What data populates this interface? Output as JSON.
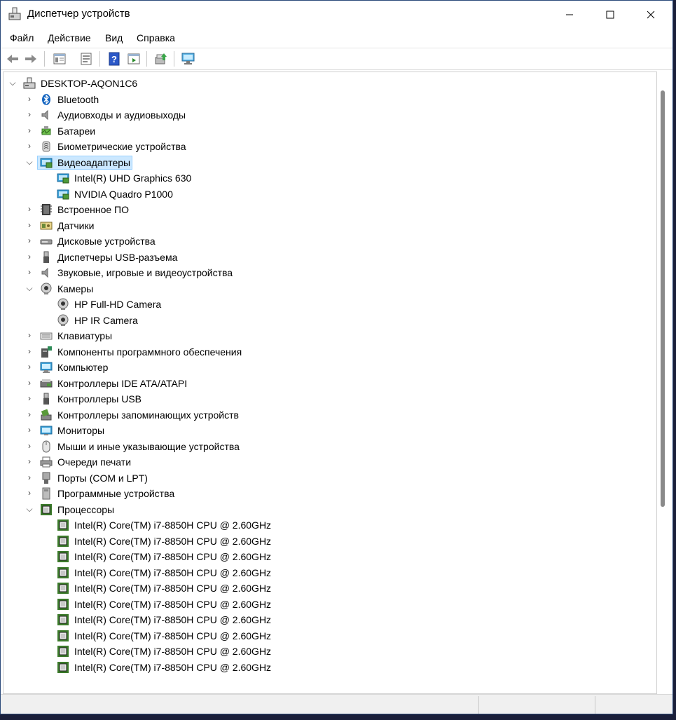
{
  "window": {
    "title": "Диспетчер устройств",
    "controls": [
      "minimize",
      "maximize",
      "close"
    ],
    "accent": "#0078d4"
  },
  "menu": [
    "Файл",
    "Действие",
    "Вид",
    "Справка"
  ],
  "toolbar": [
    "back-icon",
    "forward-icon",
    "properties-view-icon",
    "device-properties-icon",
    "help-icon",
    "show-hidden-icon",
    "update-driver-icon",
    "scan-hardware-icon"
  ],
  "tree": {
    "root": "DESKTOP-AQON1C6",
    "selected": "Видеоадаптеры",
    "rows": [
      {
        "label": "Bluetooth",
        "level": 1,
        "expand": "collapsed",
        "icon": "bluetooth-icon"
      },
      {
        "label": "Аудиовходы и аудиовыходы",
        "level": 1,
        "expand": "collapsed",
        "icon": "audio-icon"
      },
      {
        "label": "Батареи",
        "level": 1,
        "expand": "collapsed",
        "icon": "battery-icon"
      },
      {
        "label": "Биометрические устройства",
        "level": 1,
        "expand": "collapsed",
        "icon": "fingerprint-icon"
      },
      {
        "label": "Видеоадаптеры",
        "level": 1,
        "expand": "expanded",
        "icon": "display-adapter-icon"
      },
      {
        "label": "Intel(R) UHD Graphics 630",
        "level": 2,
        "expand": "none",
        "icon": "display-adapter-icon"
      },
      {
        "label": "NVIDIA Quadro P1000",
        "level": 2,
        "expand": "none",
        "icon": "display-adapter-icon"
      },
      {
        "label": "Встроенное ПО",
        "level": 1,
        "expand": "collapsed",
        "icon": "firmware-icon"
      },
      {
        "label": "Датчики",
        "level": 1,
        "expand": "collapsed",
        "icon": "sensor-icon"
      },
      {
        "label": "Дисковые устройства",
        "level": 1,
        "expand": "collapsed",
        "icon": "disk-icon"
      },
      {
        "label": "Диспетчеры USB-разъема",
        "level": 1,
        "expand": "collapsed",
        "icon": "usb-icon"
      },
      {
        "label": "Звуковые, игровые и видеоустройства",
        "level": 1,
        "expand": "collapsed",
        "icon": "audio-icon"
      },
      {
        "label": "Камеры",
        "level": 1,
        "expand": "expanded",
        "icon": "camera-icon"
      },
      {
        "label": "HP Full-HD Camera",
        "level": 2,
        "expand": "none",
        "icon": "camera-icon"
      },
      {
        "label": "HP IR Camera",
        "level": 2,
        "expand": "none",
        "icon": "camera-icon"
      },
      {
        "label": "Клавиатуры",
        "level": 1,
        "expand": "collapsed",
        "icon": "keyboard-icon"
      },
      {
        "label": "Компоненты программного обеспечения",
        "level": 1,
        "expand": "collapsed",
        "icon": "software-component-icon"
      },
      {
        "label": "Компьютер",
        "level": 1,
        "expand": "collapsed",
        "icon": "computer-icon"
      },
      {
        "label": "Контроллеры IDE ATA/ATAPI",
        "level": 1,
        "expand": "collapsed",
        "icon": "ide-controller-icon"
      },
      {
        "label": "Контроллеры USB",
        "level": 1,
        "expand": "collapsed",
        "icon": "usb-icon"
      },
      {
        "label": "Контроллеры запоминающих устройств",
        "level": 1,
        "expand": "collapsed",
        "icon": "storage-controller-icon"
      },
      {
        "label": "Мониторы",
        "level": 1,
        "expand": "collapsed",
        "icon": "monitor-icon"
      },
      {
        "label": "Мыши и иные указывающие устройства",
        "level": 1,
        "expand": "collapsed",
        "icon": "mouse-icon"
      },
      {
        "label": "Очереди печати",
        "level": 1,
        "expand": "collapsed",
        "icon": "printer-icon"
      },
      {
        "label": "Порты (COM и LPT)",
        "level": 1,
        "expand": "collapsed",
        "icon": "port-icon"
      },
      {
        "label": "Программные устройства",
        "level": 1,
        "expand": "collapsed",
        "icon": "software-device-icon"
      },
      {
        "label": "Процессоры",
        "level": 1,
        "expand": "expanded",
        "icon": "processor-icon"
      },
      {
        "label": "Intel(R) Core(TM) i7-8850H CPU @ 2.60GHz",
        "level": 2,
        "expand": "none",
        "icon": "processor-icon"
      },
      {
        "label": "Intel(R) Core(TM) i7-8850H CPU @ 2.60GHz",
        "level": 2,
        "expand": "none",
        "icon": "processor-icon"
      },
      {
        "label": "Intel(R) Core(TM) i7-8850H CPU @ 2.60GHz",
        "level": 2,
        "expand": "none",
        "icon": "processor-icon"
      },
      {
        "label": "Intel(R) Core(TM) i7-8850H CPU @ 2.60GHz",
        "level": 2,
        "expand": "none",
        "icon": "processor-icon"
      },
      {
        "label": "Intel(R) Core(TM) i7-8850H CPU @ 2.60GHz",
        "level": 2,
        "expand": "none",
        "icon": "processor-icon"
      },
      {
        "label": "Intel(R) Core(TM) i7-8850H CPU @ 2.60GHz",
        "level": 2,
        "expand": "none",
        "icon": "processor-icon"
      },
      {
        "label": "Intel(R) Core(TM) i7-8850H CPU @ 2.60GHz",
        "level": 2,
        "expand": "none",
        "icon": "processor-icon"
      },
      {
        "label": "Intel(R) Core(TM) i7-8850H CPU @ 2.60GHz",
        "level": 2,
        "expand": "none",
        "icon": "processor-icon"
      },
      {
        "label": "Intel(R) Core(TM) i7-8850H CPU @ 2.60GHz",
        "level": 2,
        "expand": "none",
        "icon": "processor-icon"
      },
      {
        "label": "Intel(R) Core(TM) i7-8850H CPU @ 2.60GHz",
        "level": 2,
        "expand": "none",
        "icon": "processor-icon"
      }
    ]
  }
}
